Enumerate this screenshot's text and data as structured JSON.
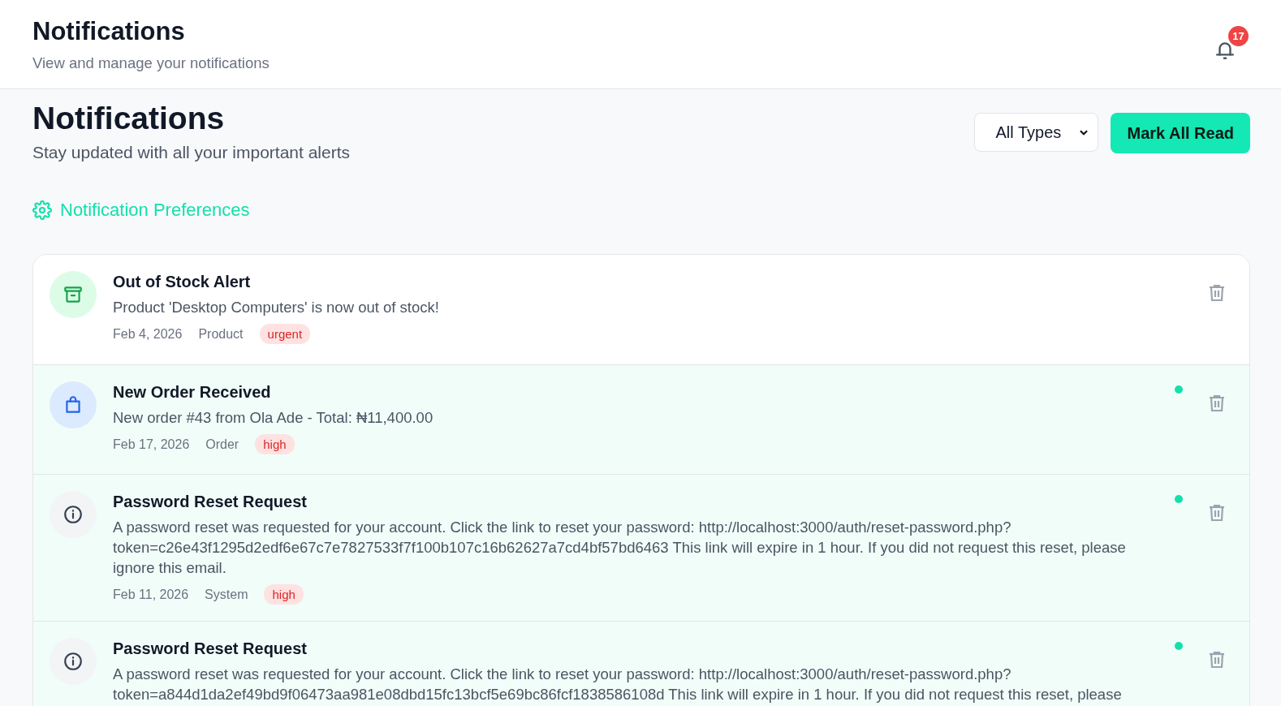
{
  "header": {
    "title": "Notifications",
    "subtitle": "View and manage your notifications",
    "unread_count": "17"
  },
  "page": {
    "title": "Notifications",
    "subtitle": "Stay updated with all your important alerts"
  },
  "filter": {
    "value": "All Types"
  },
  "mark_all_button": "Mark All Read",
  "preferences_link": "Notification Preferences",
  "notifications": [
    {
      "kind": "product",
      "title": "Out of Stock Alert",
      "message": "Product 'Desktop Computers' is now out of stock!",
      "date": "Feb 4, 2026",
      "category": "Product",
      "priority": "urgent",
      "unread": false
    },
    {
      "kind": "order",
      "title": "New Order Received",
      "message": "New order #43 from Ola Ade - Total: ₦11,400.00",
      "date": "Feb 17, 2026",
      "category": "Order",
      "priority": "high",
      "unread": true
    },
    {
      "kind": "system",
      "title": "Password Reset Request",
      "message": "A password reset was requested for your account. Click the link to reset your password: http://localhost:3000/auth/reset-password.php?token=c26e43f1295d2edf6e67c7e7827533f7f100b107c16b62627a7cd4bf57bd6463 This link will expire in 1 hour. If you did not request this reset, please ignore this email.",
      "date": "Feb 11, 2026",
      "category": "System",
      "priority": "high",
      "unread": true
    },
    {
      "kind": "system",
      "title": "Password Reset Request",
      "message": "A password reset was requested for your account. Click the link to reset your password: http://localhost:3000/auth/reset-password.php?token=a844d1da2ef49bd9f06473aa981e08dbd15fc13bcf5e69bc86fcf1838586108d This link will expire in 1 hour. If you did not request this reset, please",
      "unread": true
    }
  ]
}
